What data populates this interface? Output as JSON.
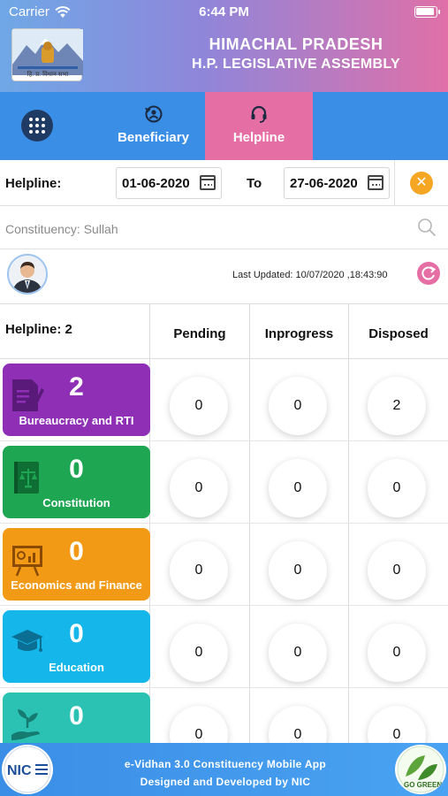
{
  "status_bar": {
    "carrier": "Carrier",
    "time": "6:44 PM",
    "battery_level": 1.0
  },
  "header": {
    "logo_caption": "हि. प्र. विधान सभा",
    "title_line1": "HIMACHAL PRADESH",
    "title_line2": "H.P. LEGISLATIVE ASSEMBLY"
  },
  "tabs": [
    {
      "label": "Beneficiary",
      "icon": "user-refresh-icon",
      "active": false
    },
    {
      "label": "Helpline",
      "icon": "headset-icon",
      "active": true
    }
  ],
  "filter": {
    "label": "Helpline:",
    "from_date": "01-06-2020",
    "to_label": "To",
    "to_date": "27-06-2020"
  },
  "search": {
    "text": "Constituency: Sullah"
  },
  "last_updated": "Last Updated: 10/07/2020 ,18:43:90",
  "table": {
    "count_label": "Helpline: 2",
    "columns": [
      "Pending",
      "Inprogress",
      "Disposed"
    ],
    "rows": [
      {
        "name": "Bureaucracy and RTI",
        "count": "2",
        "color": "#8e2fb6",
        "icon": "document-edit-icon",
        "pending": "0",
        "inprogress": "0",
        "disposed": "2"
      },
      {
        "name": "Constitution",
        "count": "0",
        "color": "#1ea652",
        "icon": "law-book-icon",
        "pending": "0",
        "inprogress": "0",
        "disposed": "0"
      },
      {
        "name": "Economics and Finance",
        "count": "0",
        "color": "#f29a16",
        "icon": "presentation-board-icon",
        "pending": "0",
        "inprogress": "0",
        "disposed": "0"
      },
      {
        "name": "Education",
        "count": "0",
        "color": "#15b6ea",
        "icon": "graduation-cap-icon",
        "pending": "0",
        "inprogress": "0",
        "disposed": "0"
      },
      {
        "name": "",
        "count": "0",
        "color": "#2bc2b4",
        "icon": "plant-hand-icon",
        "pending": "0",
        "inprogress": "0",
        "disposed": "0"
      }
    ]
  },
  "footer": {
    "line1": "e-Vidhan 3.0 Constituency Mobile App",
    "line2": "Designed and Developed by NIC",
    "left_logo_text": "NIC",
    "right_logo_text": "GO GREEN"
  },
  "colors": {
    "accent_blue": "#3b8ee6",
    "accent_pink": "#e56ea5",
    "orange": "#f5a623"
  }
}
